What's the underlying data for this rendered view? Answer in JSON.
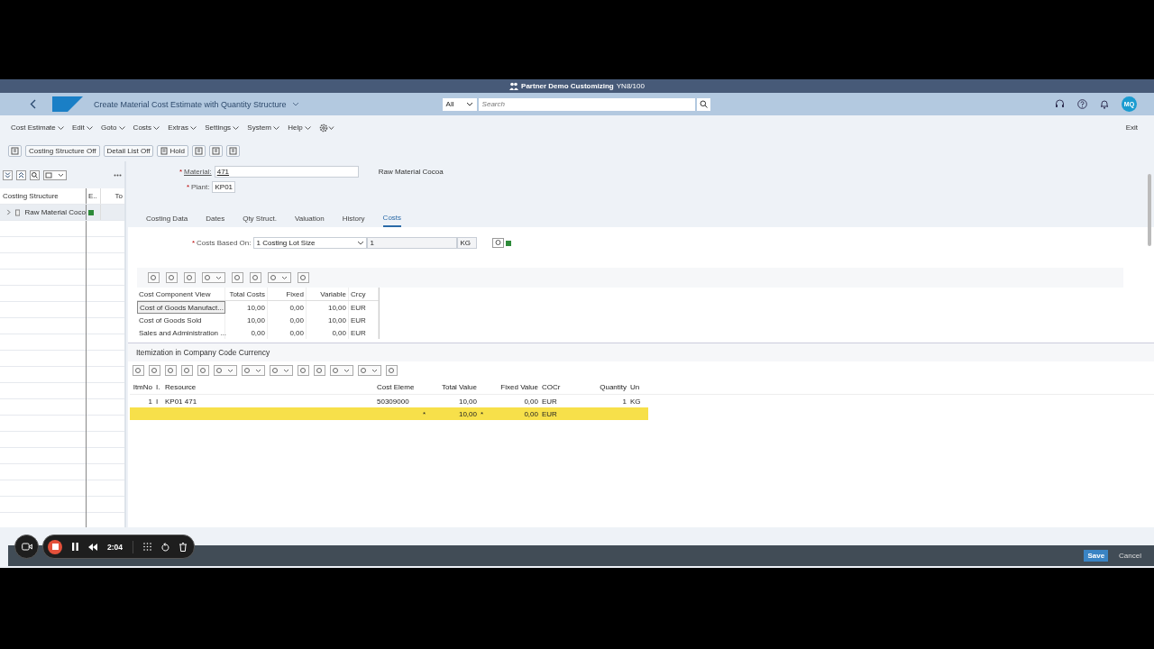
{
  "window": {
    "title": "Partner Demo Customizing",
    "system": "YN8/100"
  },
  "shell": {
    "app_title": "Create Material Cost Estimate with Quantity Structure",
    "search_scope": "All",
    "search_placeholder": "Search",
    "avatar": "MQ"
  },
  "menu": [
    "Cost Estimate",
    "Edit",
    "Goto",
    "Costs",
    "Extras",
    "Settings",
    "System",
    "Help"
  ],
  "exit": "Exit",
  "toolbar": [
    {
      "kind": "icon"
    },
    {
      "kind": "text",
      "label": "Costing Structure Off"
    },
    {
      "kind": "text",
      "label": "Detail List Off"
    },
    {
      "kind": "icon_text",
      "label": "Hold"
    },
    {
      "kind": "icon"
    },
    {
      "kind": "icon"
    },
    {
      "kind": "icon"
    }
  ],
  "tree": {
    "columns": [
      "Costing Structure",
      "E..",
      "To"
    ],
    "rows": [
      {
        "label": "Raw Material Coco",
        "expanded": false,
        "color": "#2e8b3a"
      }
    ]
  },
  "header": {
    "material_label": "Material:",
    "material": "471",
    "description": "Raw Material Cocoa",
    "plant_label": "Plant:",
    "plant": "KP01"
  },
  "tabs": [
    {
      "label": "Costing Data",
      "selected": false
    },
    {
      "label": "Dates",
      "selected": false
    },
    {
      "label": "Qty Struct.",
      "selected": false
    },
    {
      "label": "Valuation",
      "selected": false
    },
    {
      "label": "History",
      "selected": false
    },
    {
      "label": "Costs",
      "selected": true
    }
  ],
  "costs_based_on": {
    "label": "Costs Based On:",
    "value": "1 Costing Lot Size",
    "quantity": "1",
    "unit": "KG",
    "color": "#2e8b3a"
  },
  "cost_components": {
    "columns": [
      "Cost Component View",
      "Total Costs",
      "Fixed",
      "Variable",
      "Crcy"
    ],
    "rows": [
      {
        "selected": true,
        "cells": [
          "Cost of Goods Manufact...",
          "10,00",
          "0,00",
          "10,00",
          "EUR"
        ]
      },
      {
        "selected": false,
        "cells": [
          "Cost of Goods Sold",
          "10,00",
          "0,00",
          "10,00",
          "EUR"
        ]
      },
      {
        "selected": false,
        "cells": [
          "Sales and Administration ...",
          "0,00",
          "0,00",
          "0,00",
          "EUR"
        ]
      }
    ]
  },
  "itemization": {
    "title": "Itemization in Company Code Currency",
    "columns": [
      "ItmNo",
      "I.",
      "Resource",
      "Cost Eleme",
      "Total Value",
      "Fixed Value",
      "COCr",
      "Quantity",
      "Un"
    ],
    "rows": [
      {
        "kind": "item",
        "itm_no": "1",
        "i": "I",
        "resource": "KP01 471",
        "cost_element": "50309000",
        "total_value": "10,00",
        "fixed_value": "0,00",
        "currency": "EUR",
        "quantity": "1",
        "unit": "KG"
      },
      {
        "kind": "total",
        "mark1": "*",
        "total_value": "10,00",
        "mark2": "*",
        "fixed_value": "0,00",
        "currency": "EUR"
      }
    ]
  },
  "footer": {
    "buttons": [
      "Save",
      "Cancel"
    ]
  },
  "recorder": {
    "time": "2:04"
  }
}
